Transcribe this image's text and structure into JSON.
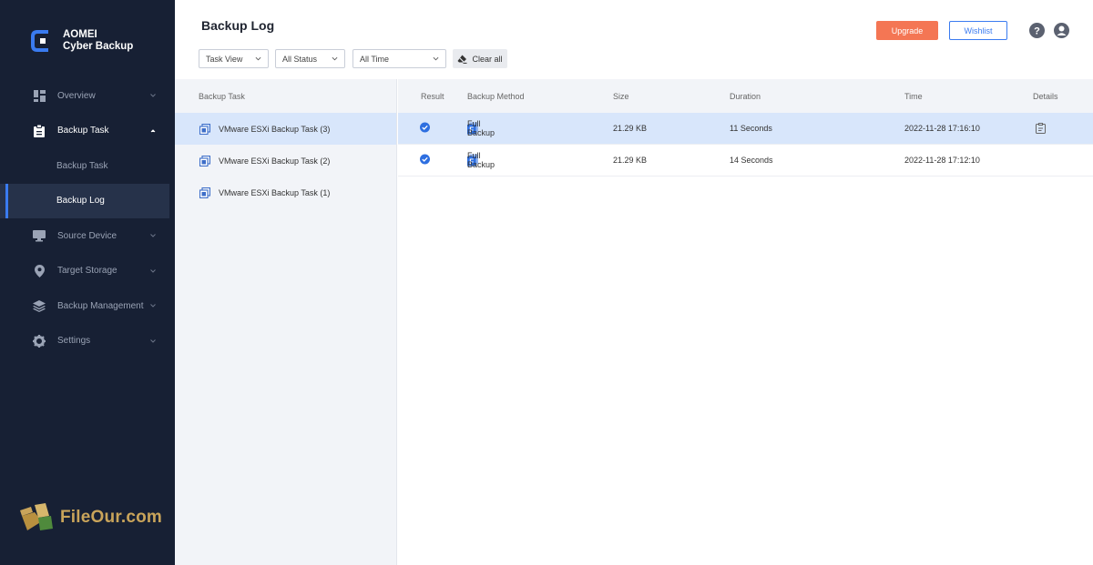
{
  "app": {
    "brand_line1": "AOMEI",
    "brand_line2": "Cyber Backup",
    "accent": "#3a7bf0",
    "sidebar_bg": "#172034"
  },
  "sidebar": {
    "items": [
      {
        "label": "Overview",
        "icon": "dashboard-icon"
      },
      {
        "label": "Backup Task",
        "icon": "clipboard-icon",
        "expanded": true,
        "children": [
          {
            "label": "Backup Task"
          },
          {
            "label": "Backup Log",
            "active": true
          }
        ]
      },
      {
        "label": "Source Device",
        "icon": "monitor-icon"
      },
      {
        "label": "Target Storage",
        "icon": "location-pin-icon"
      },
      {
        "label": "Backup Management",
        "icon": "layers-icon"
      },
      {
        "label": "Settings",
        "icon": "gear-icon"
      }
    ]
  },
  "watermark": "FileOur.com",
  "header": {
    "title": "Backup Log",
    "upgrade_label": "Upgrade",
    "upgrade_color": "#f47654",
    "wishlist_label": "Wishlist"
  },
  "filters": {
    "view": "Task View",
    "status": "All Status",
    "time": "All Time",
    "clear_label": "Clear all"
  },
  "task_list": {
    "header": "Backup Task",
    "items": [
      {
        "name": "VMware ESXi Backup Task (3)",
        "selected": true
      },
      {
        "name": "VMware ESXi Backup Task (2)"
      },
      {
        "name": "VMware ESXi Backup Task (1)"
      }
    ]
  },
  "log_table": {
    "columns": {
      "result": "Result",
      "method": "Backup Method",
      "size": "Size",
      "duration": "Duration",
      "time": "Time",
      "details": "Details"
    },
    "rows": [
      {
        "result": "success",
        "method": "Full Backup",
        "size": "21.29 KB",
        "duration": "11 Seconds",
        "time": "2022-11-28 17:16:10",
        "has_details": true
      },
      {
        "result": "success",
        "method": "Full Backup",
        "size": "21.29 KB",
        "duration": "14 Seconds",
        "time": "2022-11-28 17:12:10",
        "has_details": false
      }
    ]
  }
}
